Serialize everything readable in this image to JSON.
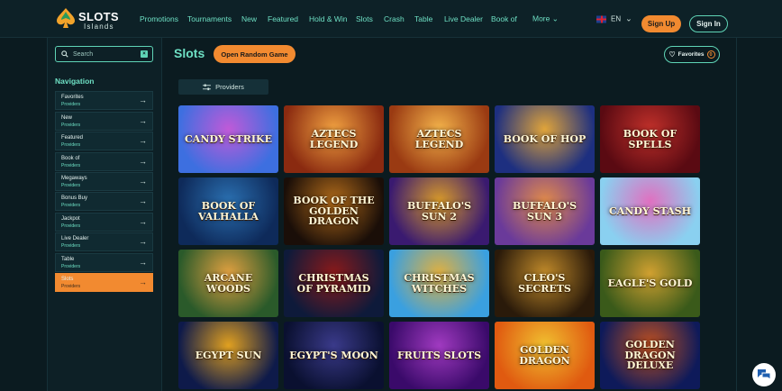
{
  "brand": {
    "name": "SLOTS",
    "sub": "Islands"
  },
  "nav": [
    {
      "label": "Promotions"
    },
    {
      "label": "Tournaments"
    },
    {
      "label": "New"
    },
    {
      "label": "Featured"
    },
    {
      "label": "Hold & Win"
    },
    {
      "label": "Slots"
    },
    {
      "label": "Crash"
    },
    {
      "label": "Table"
    },
    {
      "label": "Live Dealer"
    },
    {
      "label": "Book of"
    },
    {
      "label": "More"
    }
  ],
  "language": "EN",
  "header_buttons": {
    "signup": "Sign Up",
    "signin": "Sign In"
  },
  "search": {
    "placeholder": "Search"
  },
  "sidebar": {
    "heading": "Navigation",
    "items": [
      {
        "title": "Favorites",
        "sub": "Providers"
      },
      {
        "title": "New",
        "sub": "Providers"
      },
      {
        "title": "Featured",
        "sub": "Providers"
      },
      {
        "title": "Book of",
        "sub": "Providers"
      },
      {
        "title": "Megaways",
        "sub": "Providers"
      },
      {
        "title": "Bonus Buy",
        "sub": "Providers"
      },
      {
        "title": "Jackpot",
        "sub": "Providers"
      },
      {
        "title": "Live Dealer",
        "sub": "Providers"
      },
      {
        "title": "Table",
        "sub": "Providers"
      },
      {
        "title": "Slots",
        "sub": "Providers",
        "active": true
      }
    ]
  },
  "main": {
    "title": "Slots",
    "random_button": "Open Random Game",
    "favorites": {
      "label": "Favorites",
      "count": "0"
    },
    "providers_button": "Providers"
  },
  "games": [
    {
      "name": "Candy Strike",
      "c1": "#3d6fe0",
      "c2": "#c05ad8"
    },
    {
      "name": "Aztecs Legend",
      "c1": "#8a2a10",
      "c2": "#f0a040"
    },
    {
      "name": "Aztecs Legend",
      "c1": "#9a3a12",
      "c2": "#f3b24a"
    },
    {
      "name": "Book of Hop",
      "c1": "#1d2f80",
      "c2": "#e0a43a"
    },
    {
      "name": "Book of Spells",
      "c1": "#5a0a12",
      "c2": "#c0302a"
    },
    {
      "name": "Book of Valhalla",
      "c1": "#0e2a5a",
      "c2": "#2a6fb0"
    },
    {
      "name": "Book of the Golden Dragon",
      "c1": "#1a0e08",
      "c2": "#b06a1a"
    },
    {
      "name": "Buffalo's Sun 2",
      "c1": "#3a1a70",
      "c2": "#d89a2a"
    },
    {
      "name": "Buffalo's Sun 3",
      "c1": "#6a3a9a",
      "c2": "#e08a4a"
    },
    {
      "name": "Candy Stash",
      "c1": "#8ad0f0",
      "c2": "#e070c0"
    },
    {
      "name": "Arcane Woods",
      "c1": "#2a5a2a",
      "c2": "#e0a040"
    },
    {
      "name": "Christmas of Pyramid",
      "c1": "#0e1a3a",
      "c2": "#8a1a1a"
    },
    {
      "name": "Christmas Witches",
      "c1": "#3aa0e0",
      "c2": "#e0b040"
    },
    {
      "name": "Cleo's Secrets",
      "c1": "#2a1a0a",
      "c2": "#c08a2a"
    },
    {
      "name": "Eagle's Gold",
      "c1": "#3a5a1a",
      "c2": "#d0a030"
    },
    {
      "name": "Egypt Sun",
      "c1": "#0e1a4a",
      "c2": "#e0a020"
    },
    {
      "name": "Egypt's Moon",
      "c1": "#0a1030",
      "c2": "#3a3a8a"
    },
    {
      "name": "Fruits Slots",
      "c1": "#3a0a6a",
      "c2": "#a03ac0"
    },
    {
      "name": "Golden Dragon",
      "c1": "#e05a10",
      "c2": "#f0c030"
    },
    {
      "name": "Golden Dragon Deluxe",
      "c1": "#0e1a5a",
      "c2": "#c05020"
    }
  ]
}
